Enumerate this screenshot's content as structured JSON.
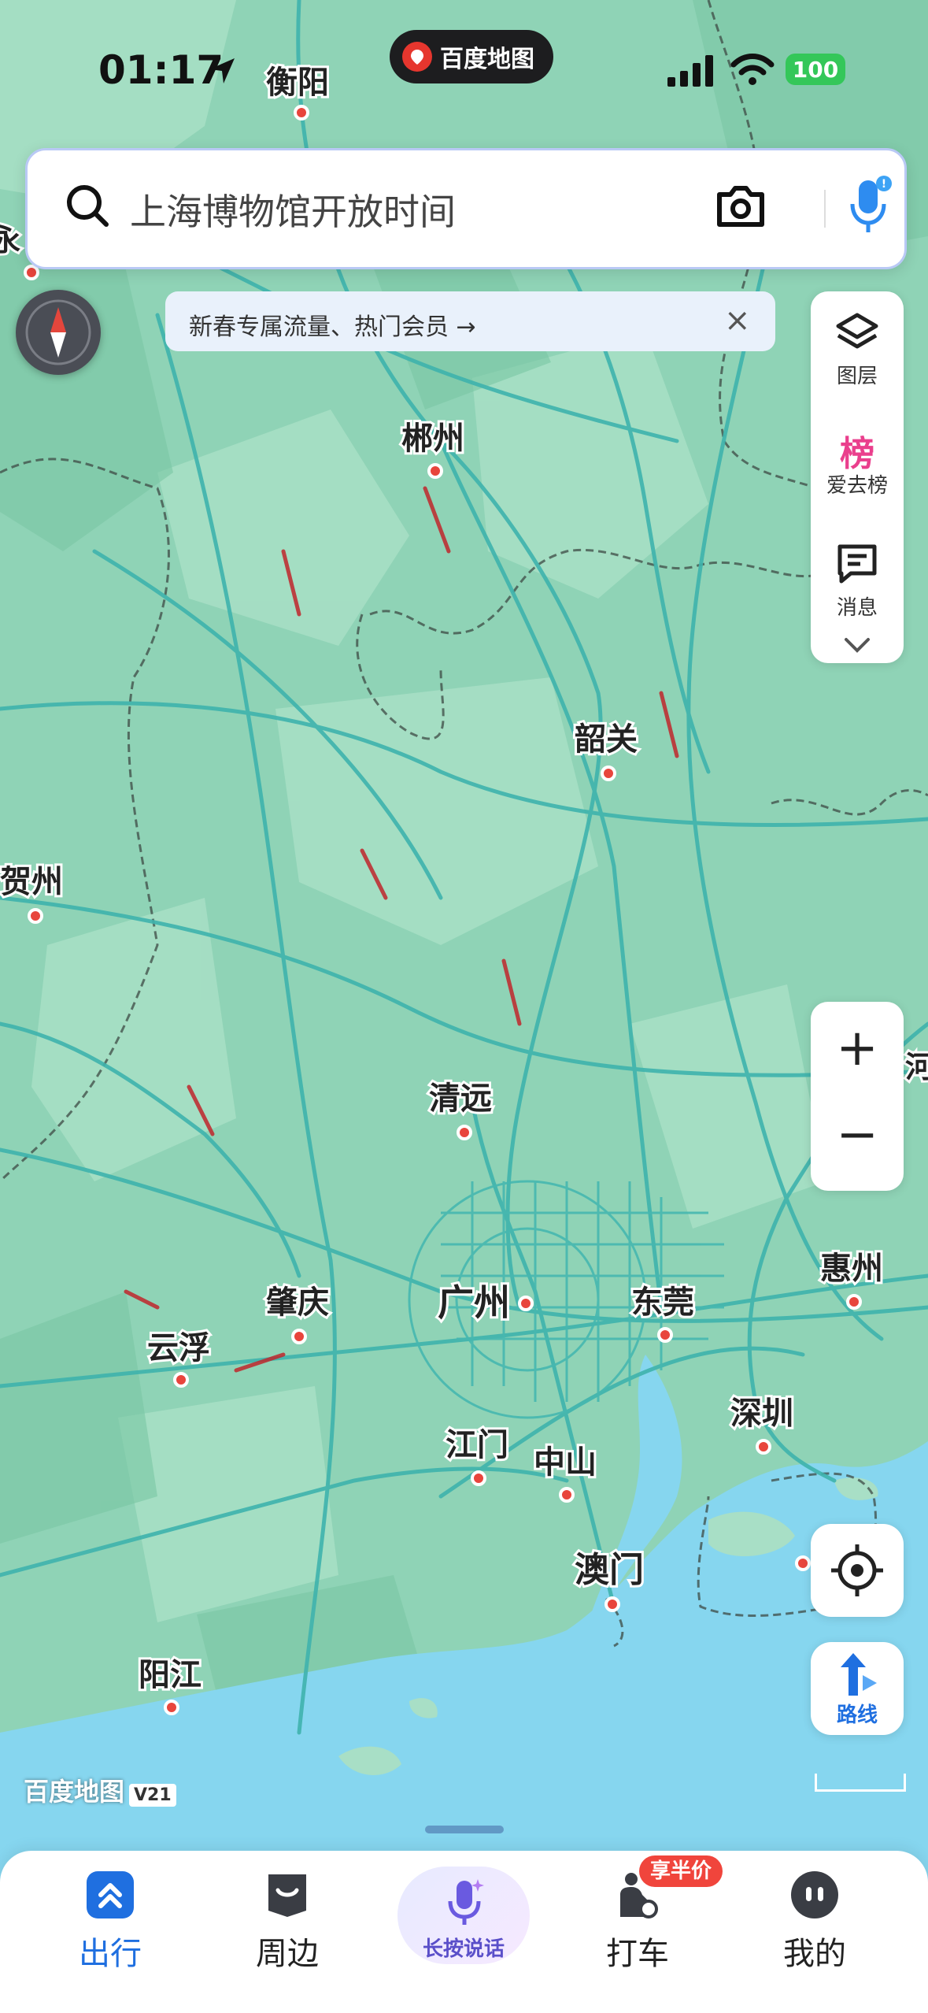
{
  "status_bar": {
    "time": "01:17",
    "battery": "100"
  },
  "app_pill": {
    "label": "百度地图"
  },
  "search": {
    "placeholder": "上海博物馆开放时间"
  },
  "banner": {
    "text": "新春专属流量、热门会员 →",
    "close": "×"
  },
  "tools": {
    "layers": "图层",
    "ranking_glyph": "榜",
    "ranking": "爱去榜",
    "messages": "消息"
  },
  "zoom": {
    "plus": "+",
    "minus": "−"
  },
  "route_button": {
    "label": "路线"
  },
  "watermark": {
    "brand": "百度地图",
    "version": "V21"
  },
  "map": {
    "cities": [
      "衡阳",
      "郴州",
      "韶关",
      "贺州",
      "清远",
      "肇庆",
      "广州",
      "东莞",
      "惠州",
      "云浮",
      "江门",
      "中山",
      "深圳",
      "澳门",
      "阳江"
    ],
    "partial_labels": [
      "永",
      "河"
    ]
  },
  "bottom_nav": {
    "items": [
      {
        "label": "出行",
        "active": true
      },
      {
        "label": "周边"
      },
      {
        "label": "长按说话"
      },
      {
        "label": "打车"
      },
      {
        "label": "我的"
      }
    ],
    "taxi_badge": "享半价"
  },
  "colors": {
    "accent": "#1f6fe0",
    "map_land": "#8fd3b6",
    "map_sea": "#7fd0ee",
    "badge": "#f0453c"
  }
}
